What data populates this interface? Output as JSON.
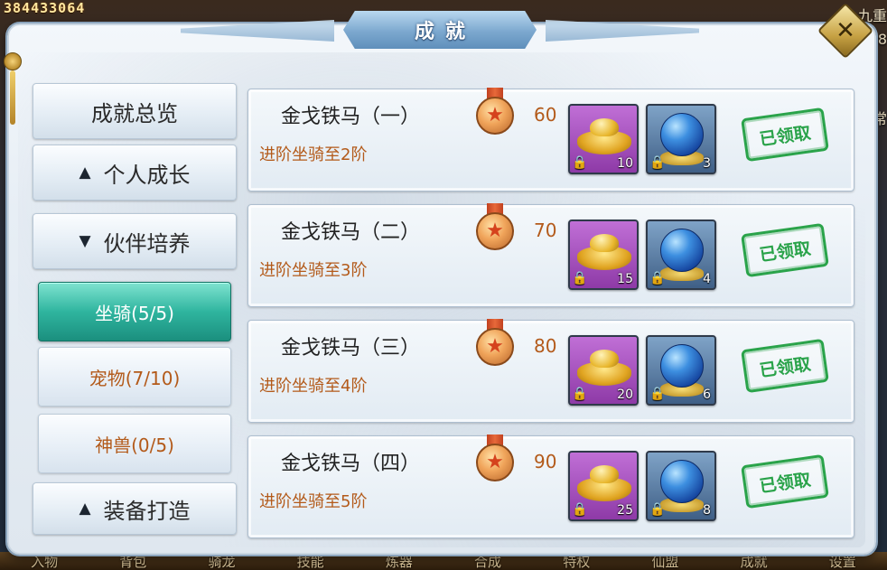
{
  "hud": {
    "currency_number": "384433064",
    "right_side_chars": [
      "九重",
      "8",
      "常"
    ],
    "bottom_menu": [
      "入物",
      "背包",
      "骑龙",
      "技能",
      "炼器",
      "合成",
      "特权",
      "仙盟",
      "成就",
      "设置"
    ]
  },
  "window": {
    "title": "成就",
    "close_label": "✕"
  },
  "sidebar": {
    "overview": "成就总览",
    "growth": "个人成长",
    "growth_chevron": "▲",
    "partner": "伙伴培养",
    "partner_chevron": "▼",
    "sub_items": [
      {
        "label": "坐骑(5/5)",
        "active": true
      },
      {
        "label": "宠物(7/10)",
        "active": false
      },
      {
        "label": "神兽(0/5)",
        "active": false
      }
    ],
    "equip": "装备打造",
    "equip_chevron": "▲"
  },
  "achievements": [
    {
      "name": "金戈铁马（一）",
      "desc": "进阶坐骑至2阶",
      "points": "60",
      "gold_qty": "10",
      "orb_qty": "3",
      "status": "已领取"
    },
    {
      "name": "金戈铁马（二）",
      "desc": "进阶坐骑至3阶",
      "points": "70",
      "gold_qty": "15",
      "orb_qty": "4",
      "status": "已领取"
    },
    {
      "name": "金戈铁马（三）",
      "desc": "进阶坐骑至4阶",
      "points": "80",
      "gold_qty": "20",
      "orb_qty": "6",
      "status": "已领取"
    },
    {
      "name": "金戈铁马（四）",
      "desc": "进阶坐骑至5阶",
      "points": "90",
      "gold_qty": "25",
      "orb_qty": "8",
      "status": "已领取"
    }
  ],
  "icons": {
    "medal": "medal-icon",
    "gold_ingot": "gold-ingot-icon",
    "spirit_orb": "spirit-orb-icon",
    "lock": "lock-icon"
  },
  "colors": {
    "accent_teal": "#2fb59f",
    "orange_text": "#b35a1a",
    "stamp_green": "#2aa34a",
    "gold_slot": "#8e3aa7",
    "orb_slot": "#3f5f86"
  }
}
